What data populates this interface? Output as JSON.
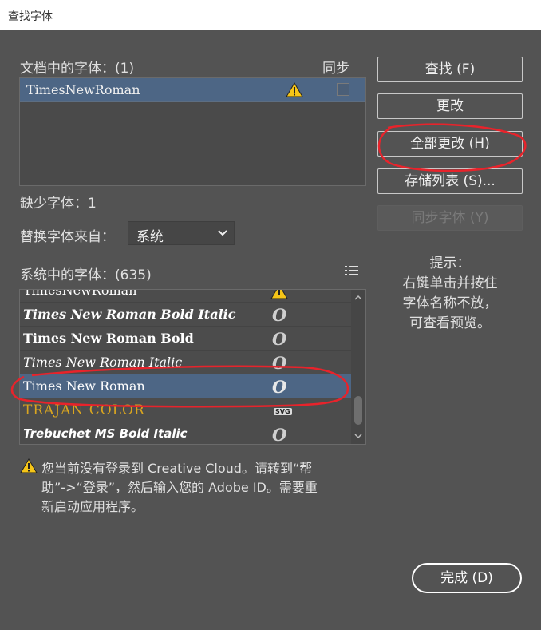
{
  "window": {
    "title": "查找字体"
  },
  "doc_fonts": {
    "label": "文档中的字体：(1)",
    "sync_label": "同步",
    "items": [
      {
        "name": "TimesNewRoman"
      }
    ]
  },
  "missing": {
    "label": "缺少字体：1"
  },
  "replace": {
    "label": "替换字体来自：",
    "selected": "系统"
  },
  "system_fonts": {
    "label": "系统中的字体：(635)",
    "items": [
      {
        "name": "TimesNewRoman",
        "type_icon": "warning-icon"
      },
      {
        "name": "Times New Roman Bold Italic",
        "type_icon": "opentype-icon",
        "type_glyph": "O"
      },
      {
        "name": "Times New Roman Bold",
        "type_icon": "opentype-icon",
        "type_glyph": "O"
      },
      {
        "name": "Times New Roman Italic",
        "type_icon": "opentype-icon",
        "type_glyph": "O"
      },
      {
        "name": "Times New Roman",
        "type_icon": "opentype-icon",
        "type_glyph": "O"
      },
      {
        "name": "TRAJAN COLOR",
        "type_icon": "svg-font-icon",
        "type_glyph": "SVG"
      },
      {
        "name": "Trebuchet MS Bold Italic",
        "type_icon": "opentype-icon",
        "type_glyph": "O"
      }
    ]
  },
  "buttons": {
    "find": "查找 (F)",
    "change": "更改",
    "change_all": "全部更改 (H)",
    "save_list": "存储列表 (S)...",
    "sync_fonts": "同步字体 (Y)",
    "done": "完成 (D)"
  },
  "tip": {
    "title": "提示：",
    "line1": "右键单击并按住",
    "line2": "字体名称不放，",
    "line3": "可查看预览。"
  },
  "warning": {
    "line1": "您当前没有登录到 Creative Cloud。请转到“帮",
    "line2": "助”->“登录”，然后输入您的 Adobe ID。需要重",
    "line3": "新启动应用程序。"
  },
  "colors": {
    "background": "#535353",
    "selection": "#4d6685",
    "annotation": "#e8232b",
    "warning": "#f5c518"
  }
}
